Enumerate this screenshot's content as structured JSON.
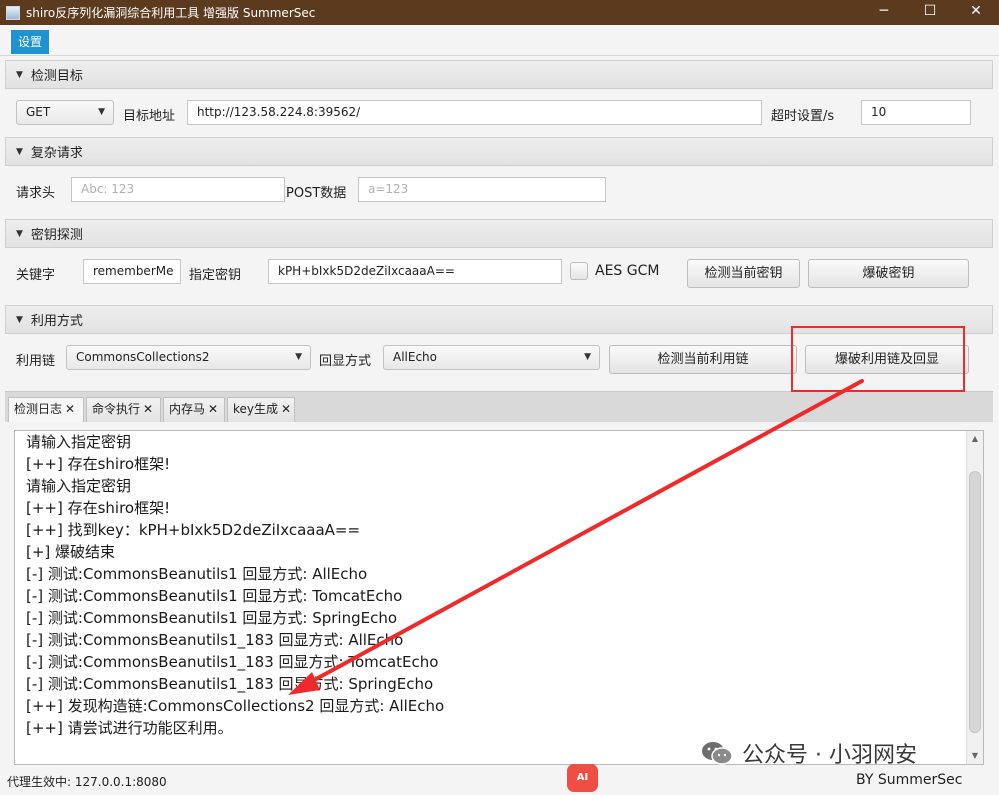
{
  "window": {
    "title": "shiro反序列化漏洞综合利用工具 增强版 SummerSec",
    "controls": {
      "minimize": "─",
      "maximize": "☐",
      "close": "✕"
    }
  },
  "menu": {
    "settings": "设置"
  },
  "target": {
    "header": "检测目标",
    "method": "GET",
    "url_label": "目标地址",
    "url": "http://123.58.224.8:39562/",
    "timeout_label": "超时设置/s",
    "timeout": "10"
  },
  "complex": {
    "header": "复杂请求",
    "headers_label": "请求头",
    "headers_placeholder": "Abc: 123",
    "post_label": "POST数据",
    "post_placeholder": "a=123"
  },
  "key_detect": {
    "header": "密钥探测",
    "keyword_label": "关键字",
    "keyword": "rememberMe",
    "key_label": "指定密钥",
    "key": "kPH+bIxk5D2deZiIxcaaaA==",
    "aes_gcm_label": "AES GCM",
    "aes_gcm_checked": false,
    "check_key_button": "检测当前密钥",
    "brute_key_button": "爆破密钥"
  },
  "exploit": {
    "header": "利用方式",
    "chain_label": "利用链",
    "chain": "CommonsCollections2",
    "echo_label": "回显方式",
    "echo": "AllEcho",
    "check_chain_button": "检测当前利用链",
    "brute_chain_button": "爆破利用链及回显"
  },
  "tabs": [
    {
      "label": "检测日志",
      "close": "✕"
    },
    {
      "label": "命令执行",
      "close": "✕"
    },
    {
      "label": "内存马",
      "close": "✕"
    },
    {
      "label": "key生成",
      "close": "✕"
    }
  ],
  "log": [
    "请输入指定密钥",
    "[++] 存在shiro框架!",
    "请输入指定密钥",
    "[++] 存在shiro框架!",
    "[++] 找到key：kPH+bIxk5D2deZiIxcaaaA==",
    "[+] 爆破结束",
    "[-] 测试:CommonsBeanutils1  回显方式: AllEcho",
    "[-] 测试:CommonsBeanutils1  回显方式: TomcatEcho",
    "[-] 测试:CommonsBeanutils1  回显方式: SpringEcho",
    "[-] 测试:CommonsBeanutils1_183  回显方式: AllEcho",
    "[-] 测试:CommonsBeanutils1_183  回显方式: TomcatEcho",
    "[-] 测试:CommonsBeanutils1_183  回显方式: SpringEcho",
    "[++] 发现构造链:CommonsCollections2  回显方式: AllEcho",
    "[++] 请尝试进行功能区利用。"
  ],
  "status": {
    "proxy": "代理生效中: 127.0.0.1:8080",
    "by": "BY   SummerSec",
    "ai_badge": "AI"
  },
  "watermark": {
    "text": "公众号 · 小羽网安"
  },
  "colors": {
    "titlebar": "#5c3a1e",
    "accent": "#1f93d0",
    "annotation": "#f02a2a"
  },
  "icons": [
    "app-icon",
    "caret-down-icon",
    "tab-close-icon",
    "wechat-icon",
    "annotation-arrow"
  ]
}
